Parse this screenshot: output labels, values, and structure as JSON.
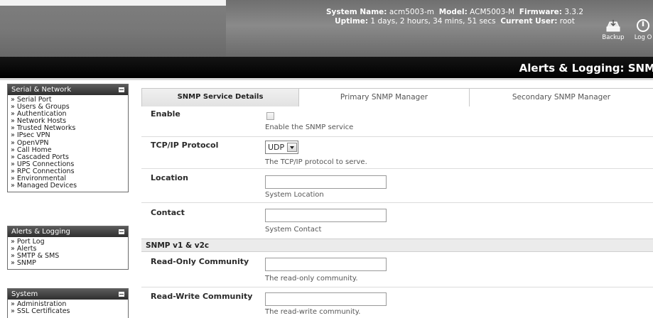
{
  "header": {
    "system_name_label": "System Name:",
    "system_name": "acm5003-m",
    "model_label": "Model:",
    "model": "ACM5003-M",
    "firmware_label": "Firmware:",
    "firmware": "3.3.2",
    "uptime_label": "Uptime:",
    "uptime": "1 days, 2 hours, 34 mins, 51 secs",
    "current_user_label": "Current User:",
    "current_user": "root",
    "backup_label": "Backup",
    "logout_label": "Log O",
    "backup_icon": "backup-icon",
    "logout_icon": "power-icon"
  },
  "title": "Alerts & Logging: SNMP",
  "sidebar": {
    "serial_network": {
      "heading": "Serial & Network",
      "items": [
        "» Serial Port",
        "» Users & Groups",
        "» Authentication",
        "» Network Hosts",
        "» Trusted Networks",
        "» IPsec VPN",
        "» OpenVPN",
        "» Call Home",
        "» Cascaded Ports",
        "» UPS Connections",
        "» RPC Connections",
        "» Environmental",
        "» Managed Devices"
      ]
    },
    "alerts_logging": {
      "heading": "Alerts & Logging",
      "items": [
        "» Port Log",
        "» Alerts",
        "» SMTP & SMS",
        "» SNMP"
      ]
    },
    "system": {
      "heading": "System",
      "items": [
        "» Administration",
        "» SSL Certificates"
      ]
    }
  },
  "tabs": [
    "SNMP Service Details",
    "Primary SNMP Manager",
    "Secondary SNMP Manager"
  ],
  "form": {
    "enable": {
      "label": "Enable",
      "checked": false,
      "help": "Enable the SNMP service"
    },
    "tcp_protocol": {
      "label": "TCP/IP Protocol",
      "value": "UDP",
      "help": "The TCP/IP protocol to serve."
    },
    "location": {
      "label": "Location",
      "value": "",
      "help": "System Location"
    },
    "contact": {
      "label": "Contact",
      "value": "",
      "help": "System Contact"
    },
    "section": "SNMP v1 & v2c",
    "read_only": {
      "label": "Read-Only Community",
      "value": "",
      "help": "The read-only community."
    },
    "read_write": {
      "label": "Read-Write Community",
      "value": "",
      "help": "The read-write community."
    }
  }
}
